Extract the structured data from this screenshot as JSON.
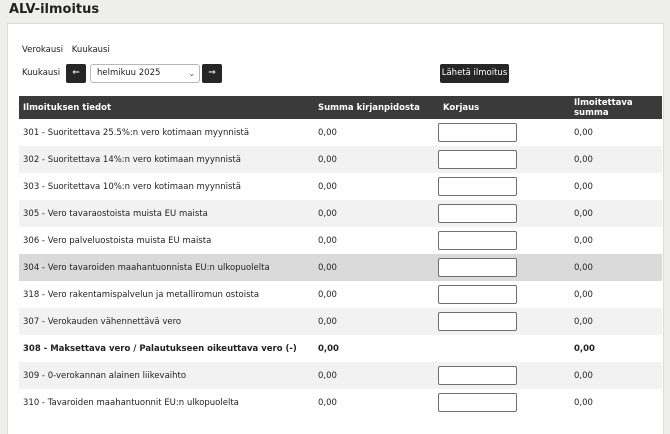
{
  "page": {
    "title": "ALV-ilmoitus"
  },
  "period": {
    "label": "Verokausi",
    "value": "Kuukausi"
  },
  "month": {
    "label": "Kuukausi",
    "selected": "helmikuu 2025",
    "prev_icon": "arrow-left-icon",
    "next_icon": "arrow-right-icon",
    "prev_glyph": "⇐",
    "next_glyph": "⇒",
    "chevron": "⌄"
  },
  "actions": {
    "send_label": "Lähetä ilmoitus"
  },
  "table": {
    "headers": [
      "Ilmoituksen tiedot",
      "Summa kirjanpidosta",
      "Korjaus",
      "Ilmoitettava summa"
    ],
    "rows": [
      {
        "label": "301 - Suoritettava 25.5%:n vero kotimaan myynnistä",
        "book": "0,00",
        "has_input": true,
        "declared": "0,00",
        "bold": false
      },
      {
        "label": "302 - Suoritettava 14%:n vero kotimaan myynnistä",
        "book": "0,00",
        "has_input": true,
        "declared": "0,00",
        "bold": false
      },
      {
        "label": "303 - Suoritettava 10%:n vero kotimaan myynnistä",
        "book": "0,00",
        "has_input": true,
        "declared": "0,00",
        "bold": false
      },
      {
        "label": "305 - Vero tavaraostoista muista EU maista",
        "book": "0,00",
        "has_input": true,
        "declared": "0,00",
        "bold": false
      },
      {
        "label": "306 - Vero palveluostoista muista EU maista",
        "book": "0,00",
        "has_input": true,
        "declared": "0,00",
        "bold": false
      },
      {
        "label": "304 - Vero tavaroiden maahantuonnista EU:n ulkopuolelta",
        "book": "0,00",
        "has_input": true,
        "declared": "0,00",
        "bold": false
      },
      {
        "label": "318 - Vero rakentamispalvelun ja metalliromun ostoista",
        "book": "0,00",
        "has_input": true,
        "declared": "0,00",
        "bold": false
      },
      {
        "label": "307 - Verokauden vähennettävä vero",
        "book": "0,00",
        "has_input": true,
        "declared": "0,00",
        "bold": false
      },
      {
        "label": "308 - Maksettava vero / Palautukseen oikeuttava vero (-)",
        "book": "0,00",
        "has_input": false,
        "declared": "0,00",
        "bold": true
      },
      {
        "label": "309 - 0-verokannan alainen liikevaihto",
        "book": "0,00",
        "has_input": true,
        "declared": "0,00",
        "bold": false
      },
      {
        "label": "310 - Tavaroiden maahantuonnit EU:n ulkopuolelta",
        "book": "0,00",
        "has_input": true,
        "declared": "0,00",
        "bold": false
      }
    ]
  },
  "colors": {
    "header_bg": "#3a3a3a",
    "button_bg": "#262626",
    "row_alt": "#f2f2f2",
    "row_hover": "#dadada"
  }
}
